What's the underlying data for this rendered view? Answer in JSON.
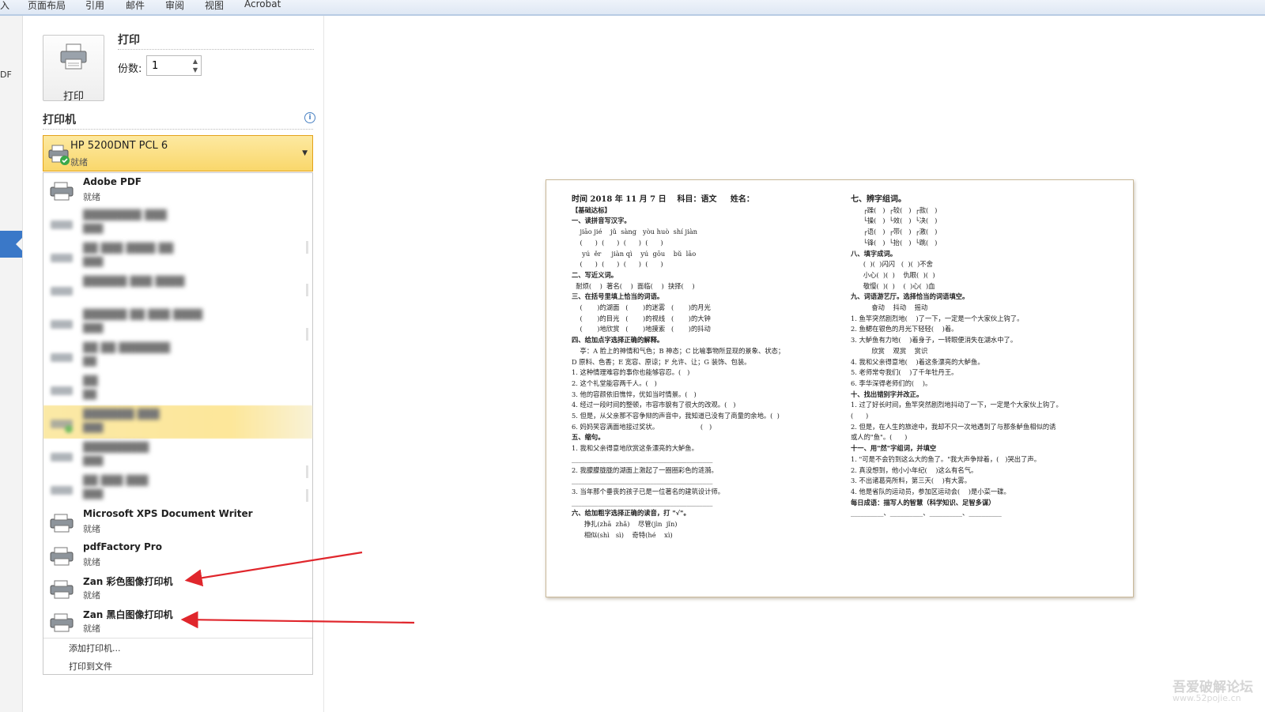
{
  "ribbon": {
    "tabs": [
      "入",
      "页面布局",
      "引用",
      "邮件",
      "审阅",
      "视图",
      "Acrobat"
    ]
  },
  "left_strip": {
    "partial_text": "DF"
  },
  "print": {
    "button_label": "打印",
    "section_title": "打印",
    "copies_label": "份数:",
    "copies_value": "1"
  },
  "printer": {
    "section_title": "打印机",
    "info_icon": "i",
    "selected": {
      "name": "HP 5200DNT PCL 6",
      "status": "就绪"
    },
    "items": [
      {
        "name": "Adobe PDF",
        "status": "就绪"
      },
      {
        "name": "████████ ███",
        "status": "███"
      },
      {
        "name": "██ ███ ████ ██",
        "status": "███"
      },
      {
        "name": "██████ ███ ████",
        "status": ""
      },
      {
        "name": "██████ ██ ███ ████",
        "status": "███"
      },
      {
        "name": "██ ██ ███████",
        "status": "██"
      },
      {
        "name": "██",
        "status": "██"
      },
      {
        "name": "███████ ███",
        "status": "███"
      },
      {
        "name": "█████████",
        "status": "███"
      },
      {
        "name": "██ ███ ███",
        "status": "███"
      },
      {
        "name": "Microsoft XPS Document Writer",
        "status": "就绪"
      },
      {
        "name": "pdfFactory Pro",
        "status": "就绪"
      },
      {
        "name": "Zan 彩色图像打印机",
        "status": "就绪"
      },
      {
        "name": "Zan 黑白图像打印机",
        "status": "就绪"
      }
    ],
    "add_printer": "添加打印机...",
    "print_to_file": "打印到文件"
  },
  "document": {
    "left": [
      "时间 2018 年 11 月 7 日    科目：语文     姓名：",
      "【基础达标】",
      "一、读拼音写汉字。",
      "    jiāo jié    jǔ  sàng   yòu huò  shí jiàn",
      "    (      )  (      )  (      )  (      )",
      "     yú  ěr     jiàn qì    yú  gōu    bǔ  lāo",
      "    (      )  (      )  (      )  (      )",
      "二、写近义词。",
      "  耐烦(    )  著名(    )  面临(    )  抉择(    )",
      "三、在括号里填上恰当的词语。",
      "    (       )的湖面   (       )的迷雾   (       )的月光",
      "    (       )的目光   (       )的视线   (       )的大钟",
      "    (       )地欣赏   (       )地摸索   (       )的抖动",
      "四、给加点字选择正确的解释。",
      "    亭：A 脸上的神情和气色；B 神态；C 比喻事物所显现的景象、状态；",
      "D 原料、色香；E 宽容、原谅；F 允许、让；G 装饰、包装。",
      "1. 这种情理难容的事你也能够容忍。(   )",
      "2. 这个礼堂能容两千人。(   )",
      "3. 他的容颜依旧憔悴，优如当时情景。(   )",
      "4. 经过一段时间的整顿，市容市貌有了很大的改观。(   )",
      "5. 但是，从父亲那不容争辩的声音中，我知道已没有了商量的余地。(  )",
      "6. 妈妈笑容满面地接过奖状。                    (   )",
      "五、缩句。",
      "1. 我和父亲得意地欣赏这条漂亮的大鲈鱼。",
      "___________________________________________",
      "2. 我朦朦胧胧的湖面上激起了一圈圈彩色的涟漪。",
      "___________________________________________",
      "3. 当年那个垂丧的孩子已是一位著名的建筑设计师。",
      "___________________________________________",
      "六、给加粗字选择正确的读音，打 \"√\"。",
      "      挣扎(zhā  zhǎ)    尽管(jìn  jǐn)",
      "      相似(shì   sì)    奇特(hé    xì)"
    ],
    "right": [
      "七、辨字组词。",
      "      ┌躁(   )  ┌较(   )  ┌款(   )",
      "      └操(   )  └效(   )  └决(   )",
      "      ┌语(   )  ┌带(   )  ┌激(   )",
      "      └锋(   )  └抬(   )  └跳(   )",
      "八、填字成词。",
      "      (  )(  )闪闪   (  )(  )不舍",
      "      小心(  )(  )    仇眼(  )(  )",
      "      敬慢(  )(  )    (  )心(  )血",
      "九、词语游艺厅。选择恰当的词语填空。",
      "          奋动    抖动    摇动",
      "1. 鱼竿突然剧烈地(    )了一下，一定是一个大家伙上钩了。",
      "2. 鱼鳃在银色的月光下轻轻(    )着。",
      "3. 大鲈鱼有力地(    )着身子，一转眼便消失在湖水中了。",
      "          欣赏    观赏    赏识",
      "4. 我和父亲得意地(    )着这条漂亮的大鲈鱼。",
      "5. 老师常夸我们(    )了千年牡丹王。",
      "6. 李华深得老师们的(    )。",
      "十、找出错别字并改正。",
      "1. 过了好长时间，鱼竿突然剧烈地抖动了一下，一定是个大家伙上钩了。",
      "(      )",
      "2. 但是，在人生的旅途中，我却不只一次地遇到了与那条鲈鱼相似的诱",
      "或人的\"鱼\"。(      )",
      "十一、用\"然\"字组词，并填空",
      "1. \"可是不会钓到这么大的鱼了。\"我大声争辩着，(   )哭出了声。",
      "2. 真没想到，他小小年纪(    )这么有名气。",
      "3. 不出诸葛亮所料，第三天(    )有大雾。",
      "4. 他是省队的运动员，参加区运动会(    )是小菜一碟。",
      "每日成语：描写人的智慧（科学知识、足智多谋）",
      "__________、__________、__________、__________"
    ]
  },
  "watermark": {
    "line1": "吾爱破解论坛",
    "line2": "www.52pojie.cn"
  },
  "colors": {
    "selected_bg": "#f9d76b",
    "arrow": "#e0262c",
    "accent_blue": "#3a78c8"
  }
}
